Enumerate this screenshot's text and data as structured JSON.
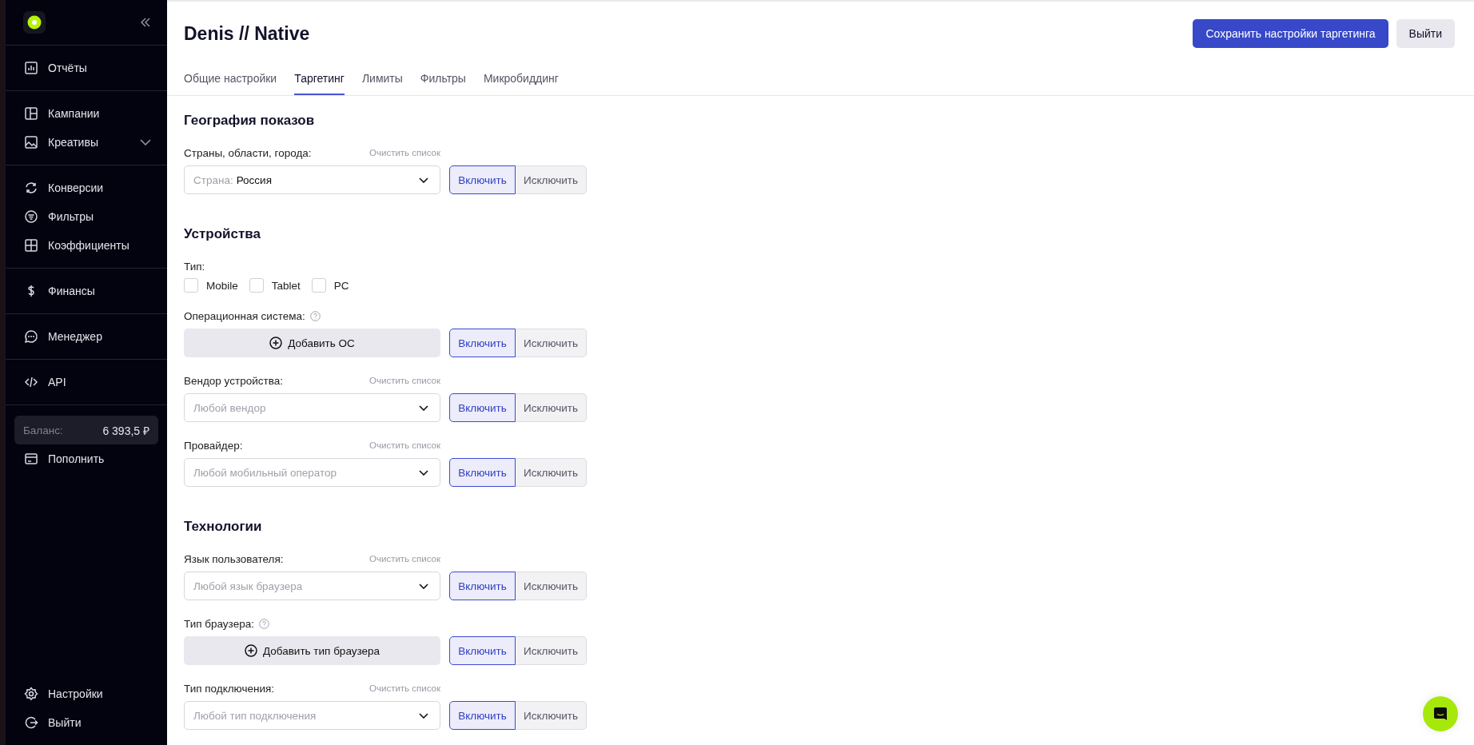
{
  "sidebar": {
    "groups": [
      {
        "items": [
          {
            "label": "Отчёты"
          }
        ]
      },
      {
        "items": [
          {
            "label": "Кампании"
          },
          {
            "label": "Креативы",
            "submenu": {
              "expanded": false
            }
          }
        ]
      },
      {
        "items": [
          {
            "label": "Конверсии"
          },
          {
            "label": "Фильтры"
          },
          {
            "label": "Коэффициенты"
          }
        ]
      },
      {
        "items": [
          {
            "label": "Финансы"
          }
        ]
      },
      {
        "items": [
          {
            "label": "Менеджер"
          }
        ]
      },
      {
        "items": [
          {
            "label": "API"
          }
        ]
      }
    ],
    "balance": {
      "label": "Баланс:",
      "value": "6 393,5 ₽"
    },
    "topup": {
      "label": "Пополнить"
    },
    "bottom_items": [
      {
        "label": "Настройки"
      },
      {
        "label": "Выйти"
      }
    ]
  },
  "header": {
    "title": "Denis // Native",
    "buttons": [
      {
        "label": "Сохранить настройки таргетинга",
        "kind": "primary"
      },
      {
        "label": "Выйти",
        "kind": "secondary"
      }
    ]
  },
  "tabs": [
    {
      "label": "Общие настройки",
      "selected": false
    },
    {
      "label": "Таргетинг",
      "selected": true
    },
    {
      "label": "Лимиты",
      "selected": false
    },
    {
      "label": "Фильтры",
      "selected": false
    },
    {
      "label": "Микробиддинг",
      "selected": false
    }
  ],
  "sections": [
    {
      "title": "География показов",
      "fields": [
        {
          "kind": "select",
          "label": "Страны, области, города:",
          "clear": "Очистить список",
          "prefix": "Страна:",
          "value": "Россия",
          "modes": [
            {
              "label": "Включить",
              "selected": true
            },
            {
              "label": "Исключить",
              "selected": false
            }
          ]
        }
      ]
    },
    {
      "title": "Устройства",
      "fields": [
        {
          "kind": "checkboxes",
          "label": "Тип:",
          "options": [
            {
              "label": "Mobile",
              "checked": false
            },
            {
              "label": "Tablet",
              "checked": false
            },
            {
              "label": "PC",
              "checked": false
            }
          ]
        },
        {
          "kind": "add",
          "label": "Операционная система:",
          "help": true,
          "button": "Добавить ОС",
          "modes": [
            {
              "label": "Включить",
              "selected": true
            },
            {
              "label": "Исключить",
              "selected": false
            }
          ]
        },
        {
          "kind": "select",
          "label": "Вендор устройства:",
          "clear": "Очистить список",
          "placeholder": "Любой вендор",
          "modes": [
            {
              "label": "Включить",
              "selected": true
            },
            {
              "label": "Исключить",
              "selected": false
            }
          ]
        },
        {
          "kind": "select",
          "label": "Провайдер:",
          "clear": "Очистить список",
          "placeholder": "Любой мобильный оператор",
          "modes": [
            {
              "label": "Включить",
              "selected": true
            },
            {
              "label": "Исключить",
              "selected": false
            }
          ]
        }
      ]
    },
    {
      "title": "Технологии",
      "fields": [
        {
          "kind": "select",
          "label": "Язык пользователя:",
          "clear": "Очистить список",
          "placeholder": "Любой язык браузера",
          "modes": [
            {
              "label": "Включить",
              "selected": true
            },
            {
              "label": "Исключить",
              "selected": false
            }
          ]
        },
        {
          "kind": "add",
          "label": "Тип браузера:",
          "help": true,
          "button": "Добавить тип браузера",
          "modes": [
            {
              "label": "Включить",
              "selected": true
            },
            {
              "label": "Исключить",
              "selected": false
            }
          ]
        },
        {
          "kind": "select",
          "label": "Тип подключения:",
          "clear": "Очистить список",
          "placeholder": "Любой тип подключения",
          "modes": [
            {
              "label": "Включить",
              "selected": true
            },
            {
              "label": "Исключить",
              "selected": false
            }
          ]
        }
      ]
    }
  ]
}
